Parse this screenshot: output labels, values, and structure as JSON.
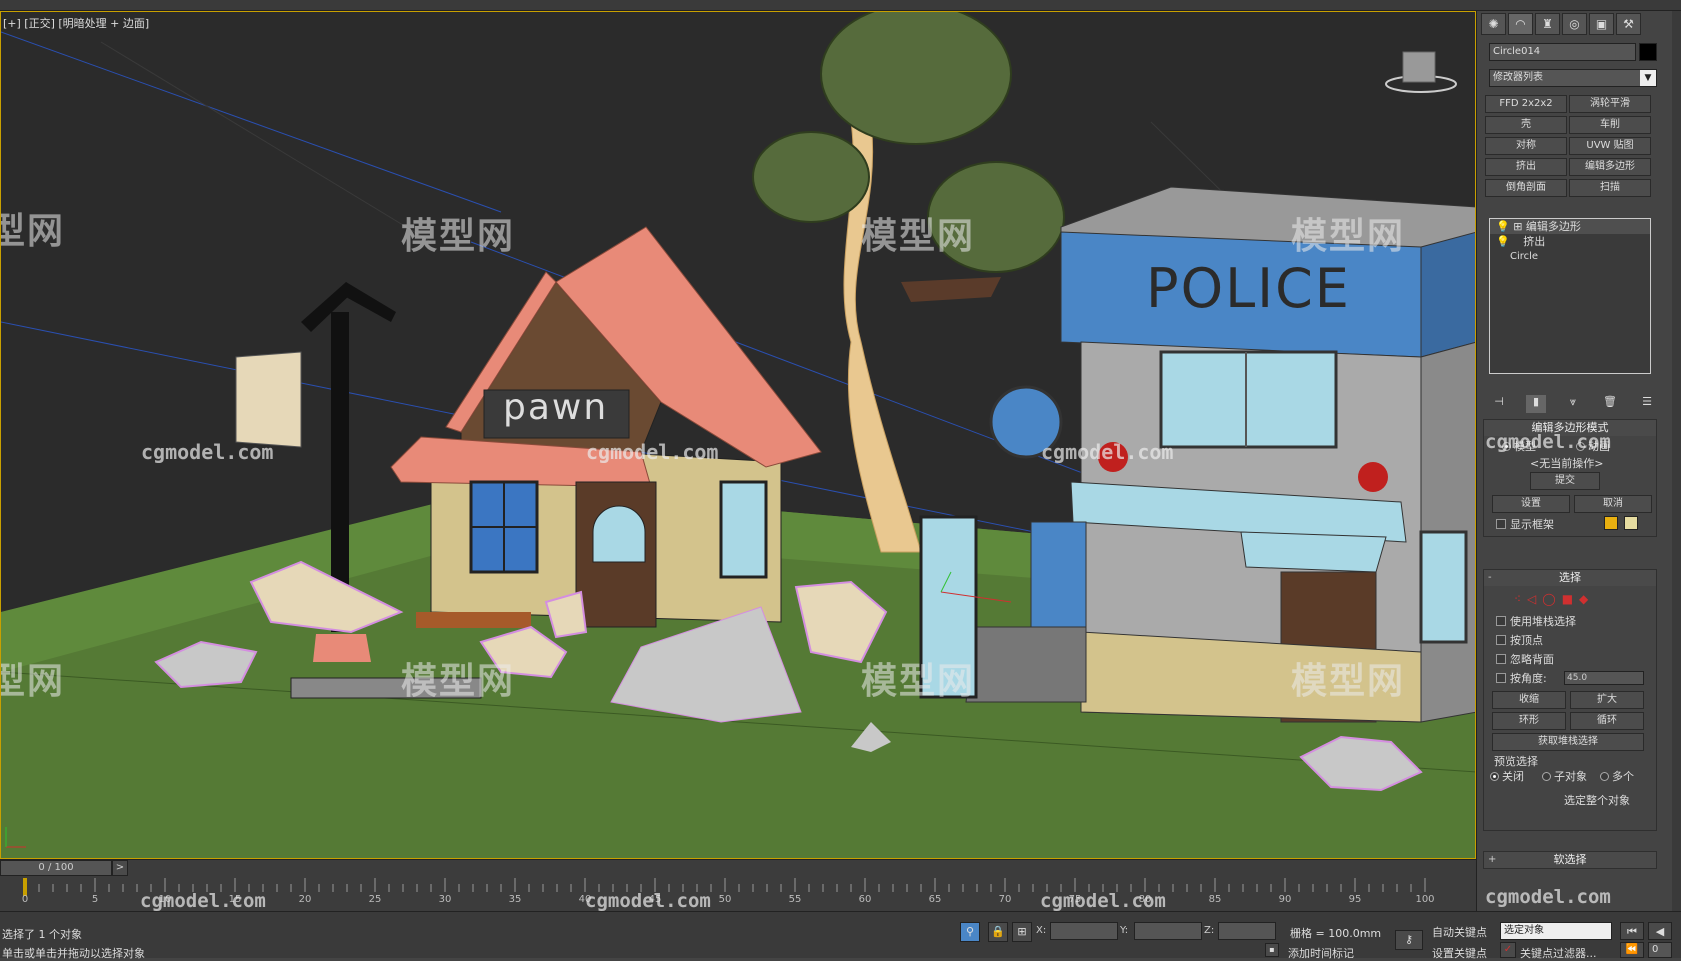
{
  "viewport": {
    "label": "[+] [正交] [明暗处理 + 边面]",
    "watermark_text": "模型网",
    "watermark_url": "cgmodel.com",
    "police_sign": "POLICE",
    "pawn_sign": "pawn"
  },
  "timeline": {
    "frame_display": "0 / 100",
    "next_button": ">",
    "ticks": [
      "0",
      "5",
      "10",
      "15",
      "20",
      "25",
      "30",
      "35",
      "40",
      "45",
      "50",
      "55",
      "60",
      "65",
      "70",
      "75",
      "80",
      "85",
      "90",
      "95",
      "100"
    ]
  },
  "status": {
    "selection_info": "选择了 1 个对象",
    "prompt": "单击或单击并拖动以选择对象",
    "x_label": "X:",
    "y_label": "Y:",
    "z_label": "Z:",
    "grid": "栅格 = 100.0mm",
    "add_time_tag": "添加时间标记",
    "auto_key": "自动关键点",
    "set_key": "设置关键点",
    "selected_object": "选定对象",
    "key_filters": "关键点过滤器...",
    "frame_value": "0"
  },
  "command_panel": {
    "tabs": [
      {
        "icon": "create-icon",
        "glyph": "✺"
      },
      {
        "icon": "modify-icon",
        "glyph": "◠"
      },
      {
        "icon": "hierarchy-icon",
        "glyph": "♜"
      },
      {
        "icon": "motion-icon",
        "glyph": "◎"
      },
      {
        "icon": "display-icon",
        "glyph": "▣"
      },
      {
        "icon": "utilities-icon",
        "glyph": "⚒"
      }
    ],
    "object_name": "Circle014",
    "modifier_list": "修改器列表",
    "modifier_buttons": [
      [
        "FFD 2x2x2",
        "涡轮平滑"
      ],
      [
        "壳",
        "车削"
      ],
      [
        "对称",
        "UVW 贴图"
      ],
      [
        "挤出",
        "编辑多边形"
      ],
      [
        "倒角剖面",
        "扫描"
      ]
    ],
    "stack": [
      "编辑多边形",
      "挤出",
      "Circle"
    ],
    "edit_poly_mode": {
      "title": "编辑多边形模式",
      "model": "模型",
      "animate": "动画",
      "no_current_op": "<无当前操作>",
      "commit": "提交",
      "settings": "设置",
      "cancel": "取消",
      "show_cage": "显示框架"
    },
    "selection": {
      "title": "选择",
      "use_stack": "使用堆栈选择",
      "by_vertex": "按顶点",
      "ignore_backfacing": "忽略背面",
      "by_angle": "按角度:",
      "angle_value": "45.0",
      "shrink": "收缩",
      "grow": "扩大",
      "ring": "环形",
      "loop": "循环",
      "get_stack_selection": "获取堆栈选择",
      "preview_selection": "预览选择",
      "off": "关闭",
      "subobject": "子对象",
      "multi": "多个",
      "select_whole": "选定整个对象"
    },
    "soft_selection": "软选择"
  },
  "colors": {
    "grass": "#557a35",
    "police_blue": "#4a86c6",
    "roof_pink": "#e88a78",
    "wall_tan": "#d3c38c",
    "selection_pink": "#d48ee0",
    "timeline_yellow": "#c8a000"
  }
}
